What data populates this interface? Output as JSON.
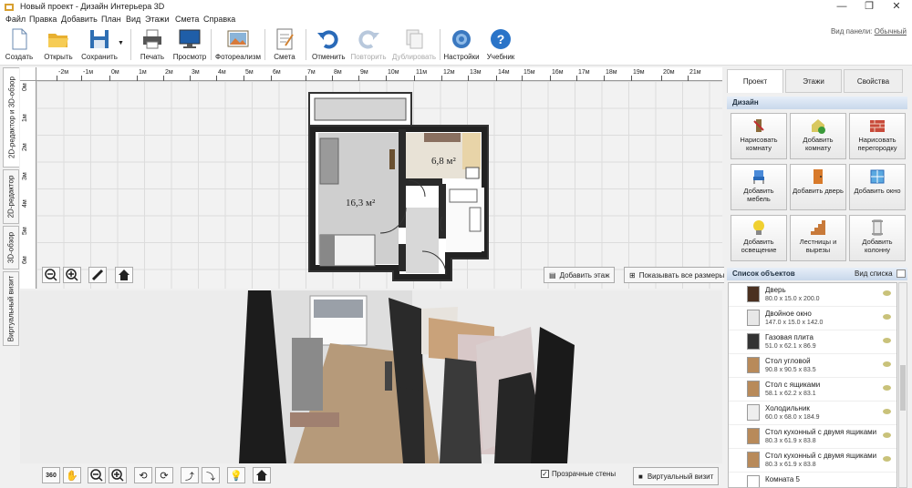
{
  "window": {
    "title": "Новый проект - Дизайн Интерьера 3D",
    "minimize": "—",
    "maximize": "❐",
    "close": "✕"
  },
  "menu": [
    "Файл",
    "Правка",
    "Добавить",
    "План",
    "Вид",
    "Этажи",
    "Смета",
    "Справка"
  ],
  "toolbar": {
    "items": [
      {
        "label": "Создать",
        "icon": "new-file-icon"
      },
      {
        "label": "Открыть",
        "icon": "folder-open-icon"
      },
      {
        "label": "Сохранить",
        "icon": "floppy-icon"
      },
      {
        "label": "Печать",
        "icon": "printer-icon"
      },
      {
        "label": "Просмотр",
        "icon": "monitor-icon"
      },
      {
        "label": "Фотореализм",
        "icon": "photo-icon"
      },
      {
        "label": "Смета",
        "icon": "estimate-icon"
      },
      {
        "label": "Отменить",
        "icon": "undo-icon"
      },
      {
        "label": "Повторить",
        "icon": "redo-icon"
      },
      {
        "label": "Дублировать",
        "icon": "duplicate-icon"
      },
      {
        "label": "Настройки",
        "icon": "gear-icon"
      },
      {
        "label": "Учебник",
        "icon": "help-icon"
      }
    ],
    "view_panel_label": "Вид панели:",
    "view_panel_value": "Обычный"
  },
  "left_tabs": [
    "2D-редактор и 3D-обзор",
    "2D-редактор",
    "3D-обзор",
    "Виртуальный визит"
  ],
  "ruler": {
    "top": [
      "-2м",
      "-1м",
      "0м",
      "1м",
      "2м",
      "3м",
      "4м",
      "5м",
      "6м",
      "7м",
      "8м",
      "9м",
      "10м",
      "11м",
      "12м",
      "13м",
      "14м",
      "15м",
      "16м",
      "17м",
      "18м",
      "19м",
      "20м",
      "21м"
    ],
    "left": [
      "0м",
      "1м",
      "2м",
      "3м",
      "4м",
      "5м",
      "6м"
    ]
  },
  "plan": {
    "room1_area": "16,3 м²",
    "room2_area": "6,8 м²"
  },
  "editor_buttons": {
    "add_floor": "Добавить этаж",
    "show_sizes": "Показывать все размеры"
  },
  "bottom": {
    "transparent_walls": "Прозрачные стены",
    "virtual_visit": "Виртуальный визит"
  },
  "right_panel": {
    "tabs": [
      "Проект",
      "Этажи",
      "Свойства"
    ],
    "design_header": "Дизайн",
    "design_buttons": [
      {
        "label": "Нарисовать комнату",
        "icon": "draw-room-icon"
      },
      {
        "label": "Добавить комнату",
        "icon": "add-room-icon"
      },
      {
        "label": "Нарисовать перегородку",
        "icon": "brick-wall-icon"
      },
      {
        "label": "Добавить мебель",
        "icon": "chair-icon"
      },
      {
        "label": "Добавить дверь",
        "icon": "door-icon"
      },
      {
        "label": "Добавить окно",
        "icon": "window-icon"
      },
      {
        "label": "Добавить освещение",
        "icon": "bulb-icon"
      },
      {
        "label": "Лестницы и вырезы",
        "icon": "stairs-icon"
      },
      {
        "label": "Добавить колонну",
        "icon": "column-icon"
      }
    ],
    "objects_header": "Список объектов",
    "list_view_label": "Вид списка",
    "objects": [
      {
        "name": "Дверь",
        "size": "80.0 x 15.0 x 200.0",
        "color": "#4a3020"
      },
      {
        "name": "Двойное окно",
        "size": "147.0 x 15.0 x 142.0",
        "color": "#e8e8e8"
      },
      {
        "name": "Газовая плита",
        "size": "51.0 x 62.1 x 86.9",
        "color": "#333333"
      },
      {
        "name": "Стол угловой",
        "size": "90.8 x 90.5 x 83.5",
        "color": "#b88a5a"
      },
      {
        "name": "Стол с ящиками",
        "size": "58.1 x 62.2 x 83.1",
        "color": "#b88a5a"
      },
      {
        "name": "Холодильник",
        "size": "60.0 x 68.0 x 184.9",
        "color": "#eeeeee"
      },
      {
        "name": "Стол кухонный с двумя ящиками",
        "size": "80.3 x 61.9 x 83.8",
        "color": "#b88a5a"
      },
      {
        "name": "Стол кухонный с двумя ящиками",
        "size": "80.3 x 61.9 x 83.8",
        "color": "#b88a5a"
      },
      {
        "name": "Комната 5",
        "size": "",
        "color": "#ffffff"
      }
    ]
  }
}
